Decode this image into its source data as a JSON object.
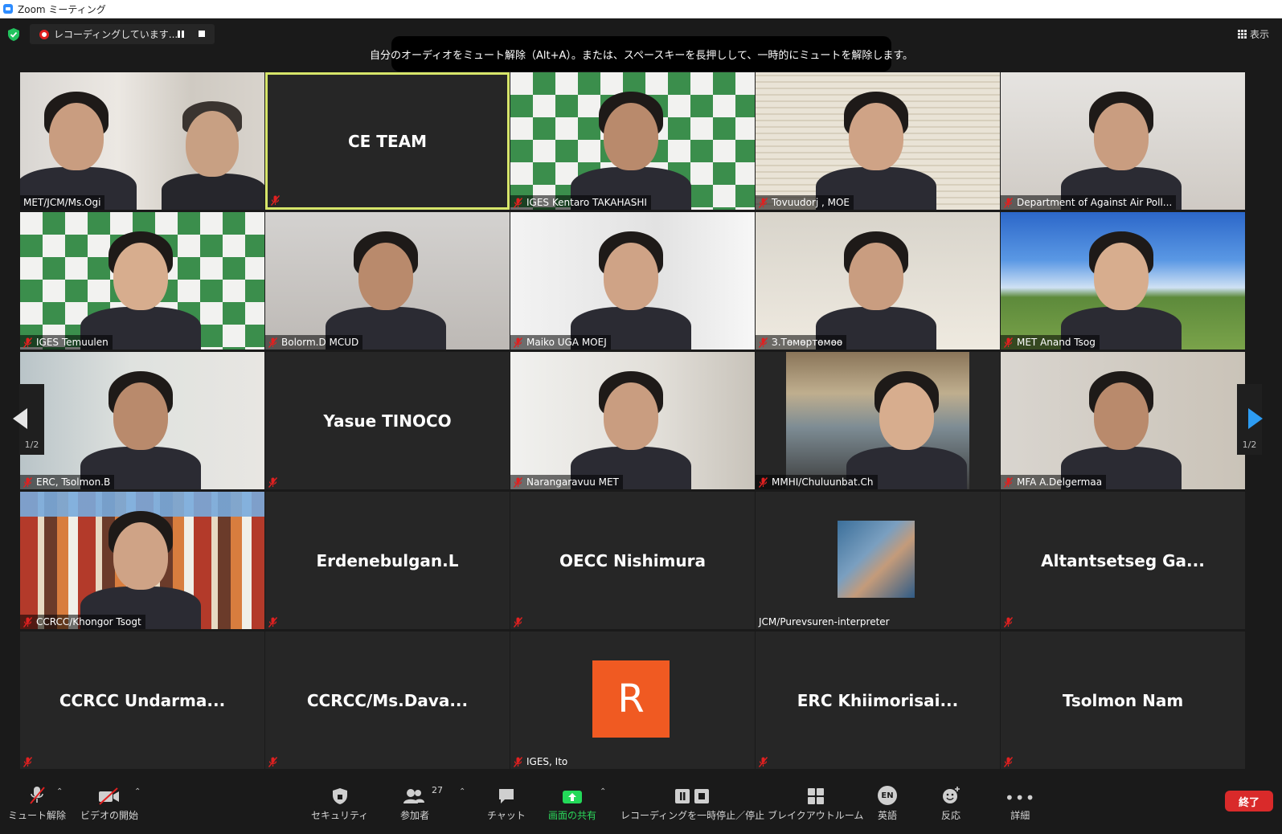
{
  "window": {
    "title": "Zoom ミーティング"
  },
  "recording": {
    "label": "レコーディングしています..."
  },
  "tooltip": {
    "text": "自分のオーディオをミュート解除（Alt+A）。または、スペースキーを長押しして、一時的にミュートを解除します。"
  },
  "view": {
    "label": "表示"
  },
  "pager": {
    "left": "1/2",
    "right": "1/2"
  },
  "tiles": [
    {
      "name": "MET/JCM/Ms.Ogi",
      "muted": false,
      "video": "office"
    },
    {
      "name": "CE TEAM",
      "muted": true,
      "video": null,
      "active": true
    },
    {
      "name": "IGES Kentaro TAKAHASHI",
      "muted": true,
      "video": "checker"
    },
    {
      "name": "Tovuudorj , MOE",
      "muted": true,
      "video": "blinds"
    },
    {
      "name": "Department of Against Air Poll...",
      "muted": true,
      "video": "wall"
    },
    {
      "name": "IGES Temuulen",
      "muted": true,
      "video": "checker"
    },
    {
      "name": "Bolorm.D MCUD",
      "muted": true,
      "video": "gray"
    },
    {
      "name": "Maiko UGA  MOEJ",
      "muted": true,
      "video": "bright"
    },
    {
      "name": "З.Төмөртөмөө",
      "muted": true,
      "video": "flag"
    },
    {
      "name": "MET Anand Tsog",
      "muted": true,
      "video": "sky"
    },
    {
      "name": "ERC, Tsolmon.B",
      "muted": true,
      "video": "room"
    },
    {
      "name": "Yasue TINOCO",
      "muted": true,
      "video": null
    },
    {
      "name": "Narangaravuu MET",
      "muted": true,
      "video": "room2"
    },
    {
      "name": "MMHI/Chuluunbat.Ch",
      "muted": true,
      "video": "car"
    },
    {
      "name": "MFA A.Delgermaa",
      "muted": true,
      "video": "wall2"
    },
    {
      "name": "CCRCC/Khongor Tsogt",
      "muted": true,
      "video": "city"
    },
    {
      "name": "Erdenebulgan.L",
      "muted": true,
      "video": null
    },
    {
      "name": "OECC Nishimura",
      "muted": true,
      "video": null
    },
    {
      "name": "JCM/Purevsuren-interpreter",
      "muted": false,
      "video": null,
      "photo": true
    },
    {
      "name": "Altantsetseg Ga...",
      "muted": true,
      "video": null
    },
    {
      "name": "CCRCC  Undarma...",
      "muted": true,
      "video": null
    },
    {
      "name": "CCRCC/Ms.Dava...",
      "muted": true,
      "video": null
    },
    {
      "name": "IGES, Ito",
      "muted": true,
      "video": null,
      "avatar_letter": "R",
      "avatar_color": "#f05a22"
    },
    {
      "name": "ERC  Khiimorisai...",
      "muted": true,
      "video": null
    },
    {
      "name": "Tsolmon Nam",
      "muted": true,
      "video": null
    }
  ],
  "toolbar": {
    "unmute": "ミュート解除",
    "start_video": "ビデオの開始",
    "security": "セキュリティ",
    "participants": "参加者",
    "participants_count": "27",
    "chat": "チャット",
    "share": "画面の共有",
    "recording": "レコーディングを一時停止／停止",
    "breakout": "ブレイクアウトルーム",
    "language_badge": "EN",
    "language": "英語",
    "reactions": "反応",
    "more": "詳細",
    "end": "終了"
  },
  "colors": {
    "active_border": "#d6e56a",
    "end_button": "#d92a2a",
    "share_green": "#23d959",
    "mute_red": "#e02020"
  }
}
